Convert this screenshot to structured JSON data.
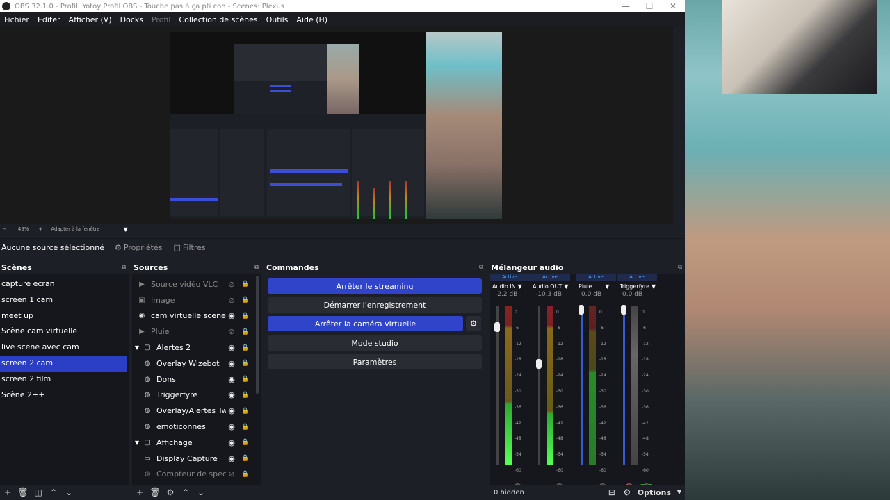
{
  "window": {
    "title": "OBS 32.1.0 - Profil: Yotoy Profil OBS - Touche pas  à ça pti con - Scènes: Plexus",
    "minimize": "—",
    "maximize": "☐",
    "close": "✕"
  },
  "menu": [
    "Fichier",
    "Editer",
    "Afficher (V)",
    "Docks",
    "Profil",
    "Collection de scènes",
    "Outils",
    "Aide (H)"
  ],
  "zoom": {
    "minus": "−",
    "value": "49%",
    "plus": "+",
    "fit": "Adapter à la fenêtre",
    "dropdown": "▼"
  },
  "source_bar": {
    "no_source": "Aucune source sélectionné",
    "properties": "Propriétés",
    "filters": "Filtres"
  },
  "scenes": {
    "title": "Scènes",
    "items": [
      "capture ecran",
      "screen 1 cam",
      "meet up",
      "Scène cam virtuelle",
      "live scene avec cam",
      "screen 2 cam",
      "screen 2 film",
      "Scène 2++"
    ],
    "selected": "screen 2 cam"
  },
  "sources": {
    "title": "Sources",
    "items": [
      {
        "label": "Source vidéo VLC",
        "icon": "▶"
      },
      {
        "label": "Image",
        "icon": "▣"
      },
      {
        "label": "cam virtuelle scene cam",
        "icon": "◉"
      },
      {
        "label": "Pluie",
        "icon": "▶"
      },
      {
        "label": "Alertes 2",
        "icon": "▢"
      },
      {
        "label": "Overlay Wizebot",
        "icon": "◍"
      },
      {
        "label": "Dons",
        "icon": "◍"
      },
      {
        "label": "Triggerfyre",
        "icon": "◍"
      },
      {
        "label": "Overlay/Alertes Twitch",
        "icon": "◍"
      },
      {
        "label": "emoticonnes",
        "icon": "◍"
      },
      {
        "label": "Affichage",
        "icon": "▢"
      },
      {
        "label": "Display Capture",
        "icon": "▭"
      },
      {
        "label": "Compteur de spectateurs",
        "icon": "◍"
      }
    ]
  },
  "commandes": {
    "title": "Commandes",
    "stop_stream": "Arrêter le streaming",
    "start_record": "Démarrer l'enregistrement",
    "stop_vcam": "Arrêter la caméra virtuelle",
    "studio": "Mode studio",
    "settings": "Paramètres"
  },
  "mixer": {
    "title": "Mélangeur audio",
    "channels": [
      {
        "active": "Active",
        "name": "Audio IN",
        "db": "-2.2 dB",
        "level": 0.85
      },
      {
        "active": "Active",
        "name": "Audio OUT",
        "db": "-10.3 dB",
        "level": 0.65
      },
      {
        "active": "Active",
        "name": "Pluie",
        "db": "0.0 dB",
        "level": 1.0
      },
      {
        "active": "Active",
        "name": "Triggerfyre",
        "db": "0.0 dB",
        "level": 1.0
      }
    ],
    "scale": [
      "0",
      "-6",
      "-12",
      "-18",
      "-24",
      "-30",
      "-36",
      "-42",
      "-48",
      "-54",
      "-60"
    ],
    "hidden": "0 hidden",
    "options": "Options"
  },
  "colors": {
    "accent": "#2f44c9",
    "bg": "#1d1f26",
    "panel": "#16171c"
  }
}
